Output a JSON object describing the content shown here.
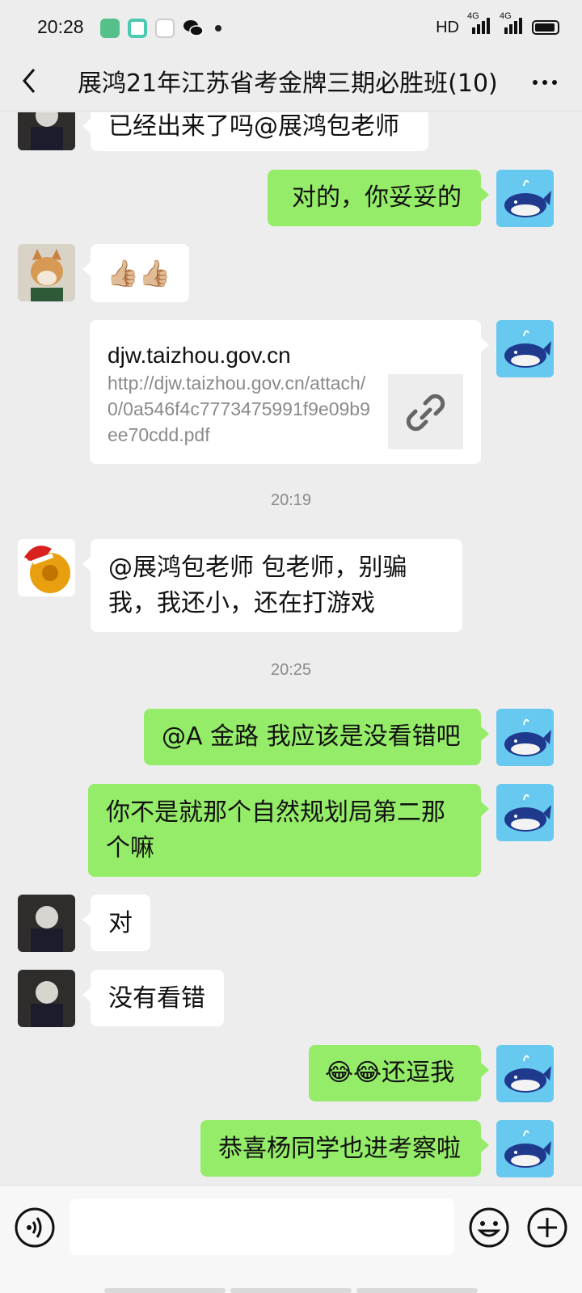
{
  "status_bar": {
    "time": "20:28",
    "network": "HD",
    "signal1": "4G",
    "signal2": "4G"
  },
  "header": {
    "title": "展鸿21年江苏省考金牌三期必胜班(10)"
  },
  "messages": [
    {
      "side": "in",
      "text": "已经出来了吗@展鸿包老师"
    },
    {
      "side": "out",
      "text": "对的，你妥妥的"
    },
    {
      "side": "in",
      "text": "👍🏼👍🏼"
    },
    {
      "side": "out",
      "type": "link",
      "title": "djw.taizhou.gov.cn",
      "url": "http://djw.taizhou.gov.cn/attach/0/0a546f4c7773475991f9e09b9ee70cdd.pdf"
    },
    {
      "type": "time",
      "text": "20:19"
    },
    {
      "side": "in",
      "text": "@展鸿包老师  包老师，别骗我，我还小，还在打游戏"
    },
    {
      "type": "time",
      "text": "20:25"
    },
    {
      "side": "out",
      "text": "@A 金路  我应该是没看错吧"
    },
    {
      "side": "out",
      "text": "你不是就那个自然规划局第二那个嘛"
    },
    {
      "side": "in",
      "text": "对"
    },
    {
      "side": "in",
      "text": "没有看错"
    },
    {
      "side": "out",
      "text": "😂😂还逗我"
    },
    {
      "side": "out",
      "text": "恭喜杨同学也进考察啦"
    }
  ],
  "colors": {
    "background": "#ededed",
    "out_bubble": "#95ec69",
    "in_bubble": "#ffffff"
  },
  "icons": {
    "back": "chevron-left-icon",
    "more": "more-dots-icon",
    "voice": "voice-icon",
    "emoji": "emoji-icon",
    "plus": "plus-icon",
    "link": "link-icon"
  }
}
